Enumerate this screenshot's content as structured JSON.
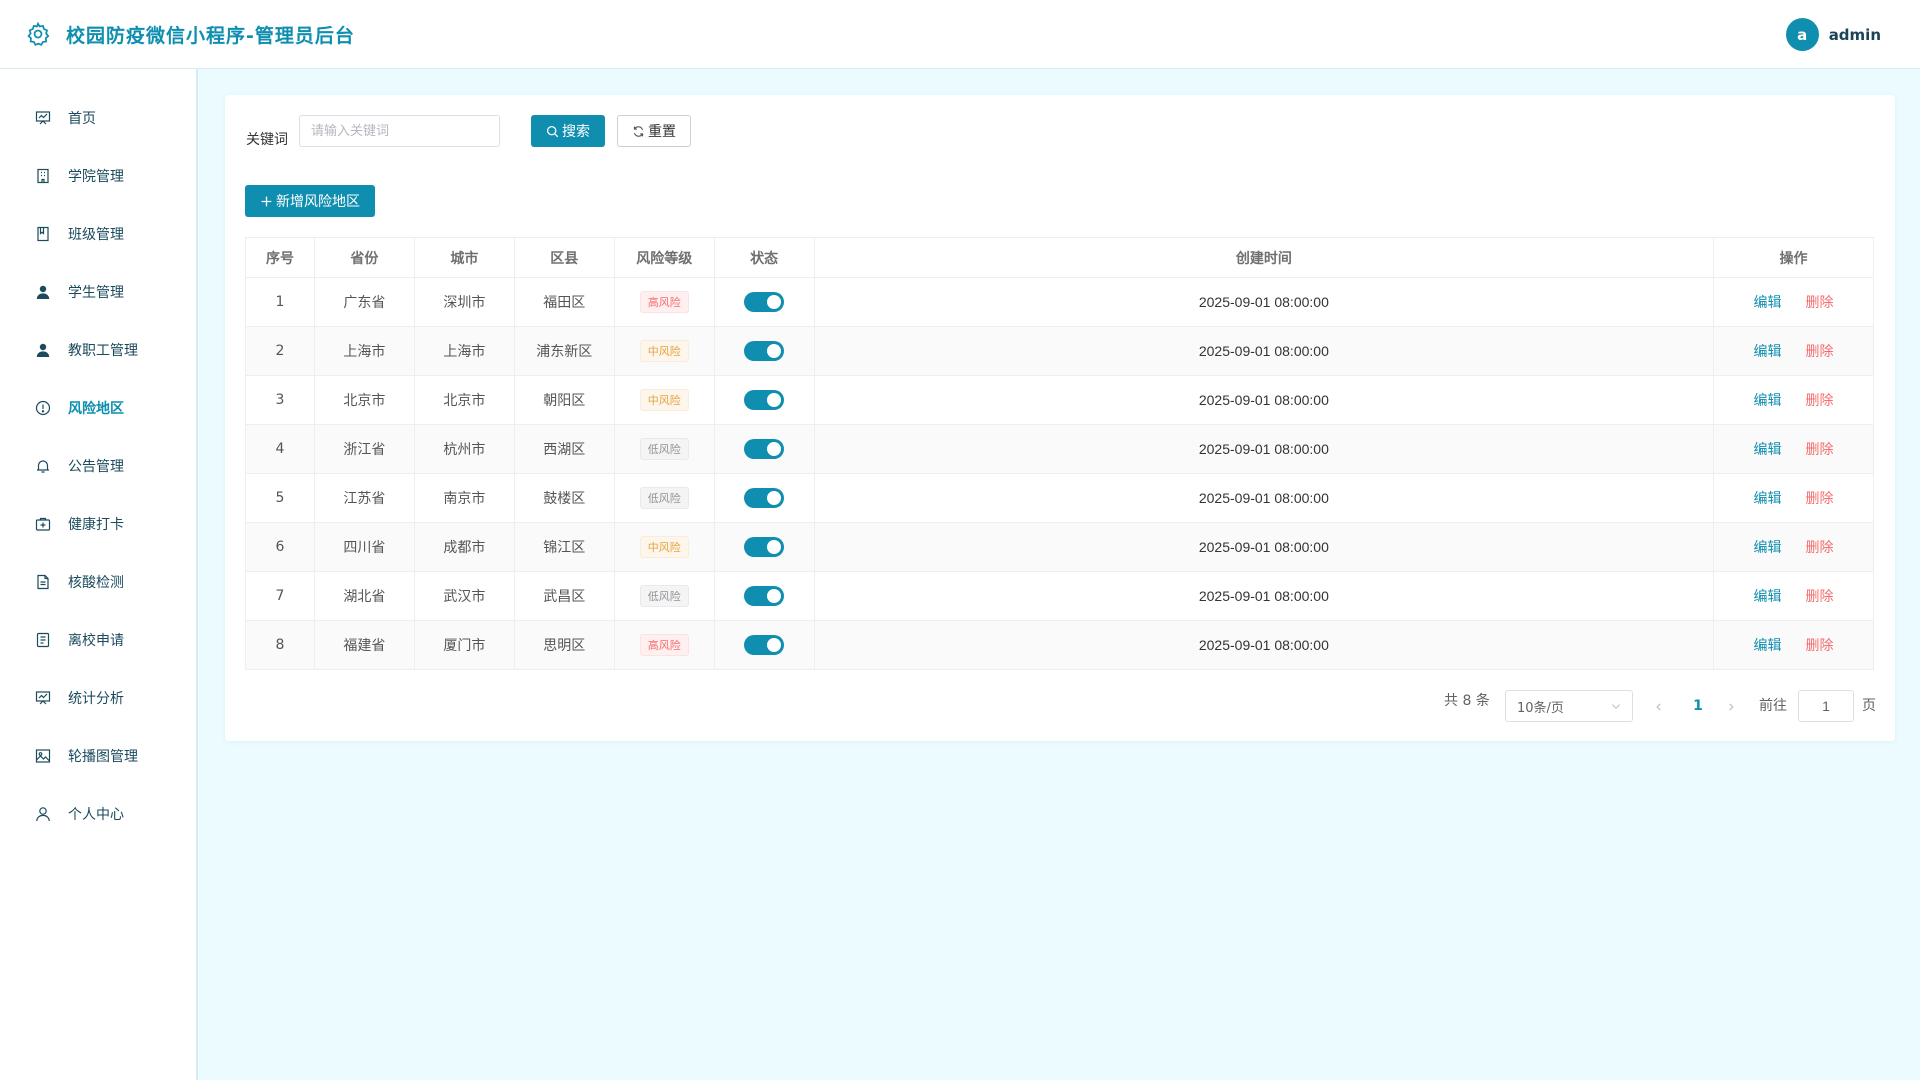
{
  "app": {
    "title": "校园防疫微信小程序-管理员后台",
    "accent": "#0f8eb0"
  },
  "user": {
    "avatar_letter": "a",
    "name": "admin"
  },
  "sidebar": {
    "items": [
      {
        "label": "首页",
        "icon": "chart-board-icon"
      },
      {
        "label": "学院管理",
        "icon": "building-icon"
      },
      {
        "label": "班级管理",
        "icon": "book-icon"
      },
      {
        "label": "学生管理",
        "icon": "user-solid-icon"
      },
      {
        "label": "教职工管理",
        "icon": "user-solid-icon"
      },
      {
        "label": "风险地区",
        "icon": "warning-circle-icon",
        "active": true
      },
      {
        "label": "公告管理",
        "icon": "bell-icon"
      },
      {
        "label": "健康打卡",
        "icon": "first-aid-kit-icon"
      },
      {
        "label": "核酸检测",
        "icon": "document-icon"
      },
      {
        "label": "离校申请",
        "icon": "notebook-icon"
      },
      {
        "label": "统计分析",
        "icon": "chart-board-icon"
      },
      {
        "label": "轮播图管理",
        "icon": "picture-icon"
      },
      {
        "label": "个人中心",
        "icon": "user-outline-icon"
      }
    ]
  },
  "search": {
    "label": "关键词",
    "placeholder": "请输入关键词",
    "value": "",
    "search_label": "搜索",
    "reset_label": "重置"
  },
  "toolbar": {
    "add_label": "新增风险地区"
  },
  "table": {
    "columns": [
      "序号",
      "省份",
      "城市",
      "区县",
      "风险等级",
      "状态",
      "创建时间",
      "操作"
    ],
    "rows": [
      {
        "index": "1",
        "province": "广东省",
        "city": "深圳市",
        "district": "福田区",
        "risk": "高风险",
        "risk_level": "high",
        "enabled": true,
        "created": "2025-09-01 08:00:00"
      },
      {
        "index": "2",
        "province": "上海市",
        "city": "上海市",
        "district": "浦东新区",
        "risk": "中风险",
        "risk_level": "medium",
        "enabled": true,
        "created": "2025-09-01 08:00:00"
      },
      {
        "index": "3",
        "province": "北京市",
        "city": "北京市",
        "district": "朝阳区",
        "risk": "中风险",
        "risk_level": "medium",
        "enabled": true,
        "created": "2025-09-01 08:00:00"
      },
      {
        "index": "4",
        "province": "浙江省",
        "city": "杭州市",
        "district": "西湖区",
        "risk": "低风险",
        "risk_level": "low",
        "enabled": true,
        "created": "2025-09-01 08:00:00"
      },
      {
        "index": "5",
        "province": "江苏省",
        "city": "南京市",
        "district": "鼓楼区",
        "risk": "低风险",
        "risk_level": "low",
        "enabled": true,
        "created": "2025-09-01 08:00:00"
      },
      {
        "index": "6",
        "province": "四川省",
        "city": "成都市",
        "district": "锦江区",
        "risk": "中风险",
        "risk_level": "medium",
        "enabled": true,
        "created": "2025-09-01 08:00:00"
      },
      {
        "index": "7",
        "province": "湖北省",
        "city": "武汉市",
        "district": "武昌区",
        "risk": "低风险",
        "risk_level": "low",
        "enabled": true,
        "created": "2025-09-01 08:00:00"
      },
      {
        "index": "8",
        "province": "福建省",
        "city": "厦门市",
        "district": "思明区",
        "risk": "高风险",
        "risk_level": "high",
        "enabled": true,
        "created": "2025-09-01 08:00:00"
      }
    ],
    "edit_label": "编辑",
    "delete_label": "删除",
    "risk_colors": {
      "high": {
        "text": "#f56c6c",
        "bg": "#fef0f0",
        "border": "#fde2e2"
      },
      "medium": {
        "text": "#e6a23c",
        "bg": "#fdf6ec",
        "border": "#faecd8"
      },
      "low": {
        "text": "#909399",
        "bg": "#f4f4f5",
        "border": "#e9e9eb"
      }
    }
  },
  "pagination": {
    "total_text": "共 8 条",
    "page_size": "10条/页",
    "current_page": "1",
    "goto_label": "前往",
    "goto_value": "1",
    "page_suffix": "页"
  }
}
